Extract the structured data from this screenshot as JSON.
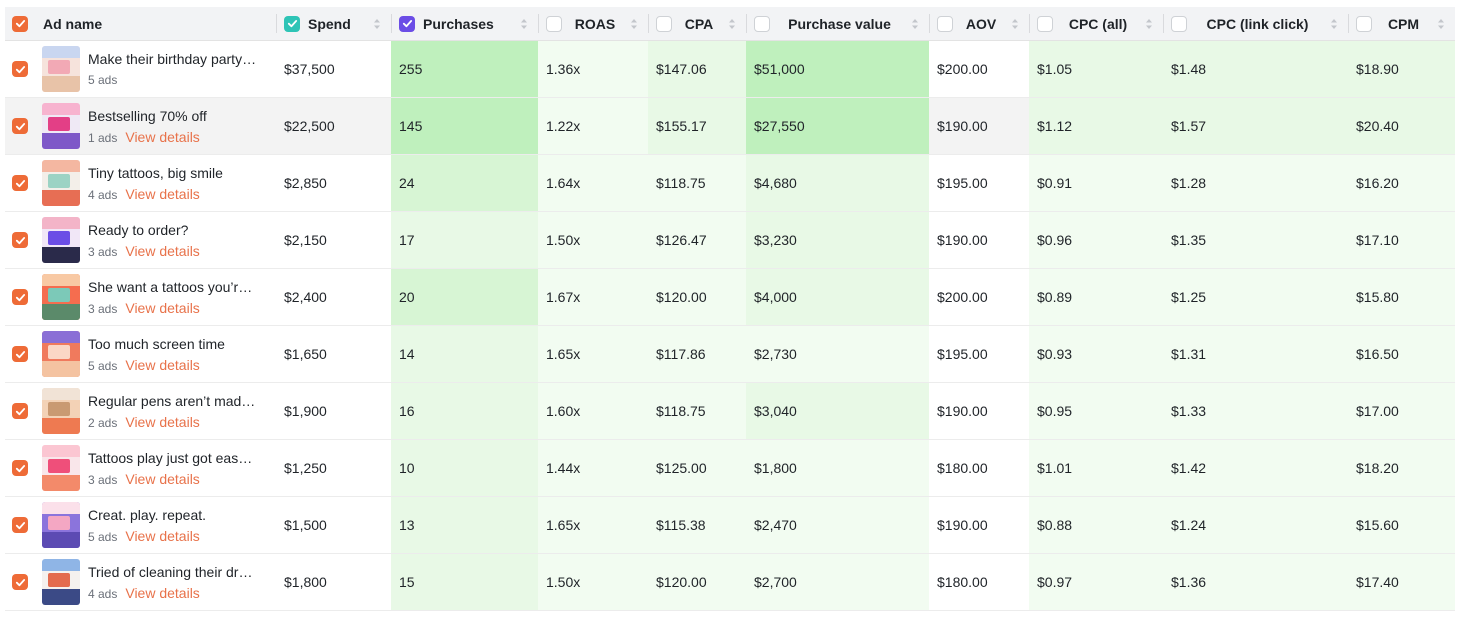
{
  "colors": {
    "accent": "#ee6b37",
    "spend_check": "#2ec4b6",
    "purchases_check": "#6b4de6",
    "link": "#e8724a",
    "heat_strong": "#bff0bd",
    "heat_medium": "#d7f5d4",
    "heat_light": "#e8f9e6",
    "heat_faint": "#f2fcf1"
  },
  "header": {
    "select_all_checked": true,
    "columns": [
      {
        "label": "Ad name",
        "checkbox": "orange"
      },
      {
        "label": "Spend",
        "checkbox": "teal"
      },
      {
        "label": "Purchases",
        "checkbox": "purple"
      },
      {
        "label": "ROAS",
        "checkbox": "empty"
      },
      {
        "label": "CPA",
        "checkbox": "empty"
      },
      {
        "label": "Purchase value",
        "checkbox": "empty"
      },
      {
        "label": "AOV",
        "checkbox": "empty"
      },
      {
        "label": "CPC (all)",
        "checkbox": "empty"
      },
      {
        "label": "CPC (link click)",
        "checkbox": "empty"
      },
      {
        "label": "CPM",
        "checkbox": "empty"
      }
    ]
  },
  "rows": [
    {
      "name": "Make their birthday party…",
      "ads": "5 ads",
      "view": "",
      "spend": "$37,500",
      "purchases": "255",
      "roas": "1.36x",
      "cpa": "$147.06",
      "purchase_value": "$51,000",
      "aov": "$200.00",
      "cpc_all": "$1.05",
      "cpc_link": "$1.48",
      "cpm": "$18.90",
      "highlight": false
    },
    {
      "name": "Bestselling 70% off",
      "ads": "1 ads",
      "view": "View details",
      "spend": "$22,500",
      "purchases": "145",
      "roas": "1.22x",
      "cpa": "$155.17",
      "purchase_value": "$27,550",
      "aov": "$190.00",
      "cpc_all": "$1.12",
      "cpc_link": "$1.57",
      "cpm": "$20.40",
      "highlight": true
    },
    {
      "name": "Tiny tattoos, big smile",
      "ads": "4 ads",
      "view": "View details",
      "spend": "$2,850",
      "purchases": "24",
      "roas": "1.64x",
      "cpa": "$118.75",
      "purchase_value": "$4,680",
      "aov": "$195.00",
      "cpc_all": "$0.91",
      "cpc_link": "$1.28",
      "cpm": "$16.20",
      "highlight": false
    },
    {
      "name": "Ready to order?",
      "ads": "3 ads",
      "view": "View details",
      "spend": "$2,150",
      "purchases": "17",
      "roas": "1.50x",
      "cpa": "$126.47",
      "purchase_value": "$3,230",
      "aov": "$190.00",
      "cpc_all": "$0.96",
      "cpc_link": "$1.35",
      "cpm": "$17.10",
      "highlight": false
    },
    {
      "name": "She want a tattoos you’r…",
      "ads": "3 ads",
      "view": "View details",
      "spend": "$2,400",
      "purchases": "20",
      "roas": "1.67x",
      "cpa": "$120.00",
      "purchase_value": "$4,000",
      "aov": "$200.00",
      "cpc_all": "$0.89",
      "cpc_link": "$1.25",
      "cpm": "$15.80",
      "highlight": false
    },
    {
      "name": "Too much screen time",
      "ads": "5 ads",
      "view": "View details",
      "spend": "$1,650",
      "purchases": "14",
      "roas": "1.65x",
      "cpa": "$117.86",
      "purchase_value": "$2,730",
      "aov": "$195.00",
      "cpc_all": "$0.93",
      "cpc_link": "$1.31",
      "cpm": "$16.50",
      "highlight": false
    },
    {
      "name": "Regular pens aren’t mad…",
      "ads": "2 ads",
      "view": "View details",
      "spend": "$1,900",
      "purchases": "16",
      "roas": "1.60x",
      "cpa": "$118.75",
      "purchase_value": "$3,040",
      "aov": "$190.00",
      "cpc_all": "$0.95",
      "cpc_link": "$1.33",
      "cpm": "$17.00",
      "highlight": false
    },
    {
      "name": "Tattoos play just got eas…",
      "ads": "3 ads",
      "view": "View details",
      "spend": "$1,250",
      "purchases": "10",
      "roas": "1.44x",
      "cpa": "$125.00",
      "purchase_value": "$1,800",
      "aov": "$180.00",
      "cpc_all": "$1.01",
      "cpc_link": "$1.42",
      "cpm": "$18.20",
      "highlight": false
    },
    {
      "name": "Creat. play. repeat.",
      "ads": "5 ads",
      "view": "View details",
      "spend": "$1,500",
      "purchases": "13",
      "roas": "1.65x",
      "cpa": "$115.38",
      "purchase_value": "$2,470",
      "aov": "$190.00",
      "cpc_all": "$0.88",
      "cpc_link": "$1.24",
      "cpm": "$15.60",
      "highlight": false
    },
    {
      "name": "Tried of cleaning their dra…",
      "ads": "4 ads",
      "view": "View details",
      "spend": "$1,800",
      "purchases": "15",
      "roas": "1.50x",
      "cpa": "$120.00",
      "purchase_value": "$2,700",
      "aov": "$180.00",
      "cpc_all": "$0.97",
      "cpc_link": "$1.36",
      "cpm": "$17.40",
      "highlight": false
    }
  ],
  "heat": [
    {
      "purchases": "strong",
      "roas": "faint",
      "cpa": "light",
      "purchase_value": "strong",
      "cpc_all": "light",
      "cpc_link": "light",
      "cpm": "light"
    },
    {
      "purchases": "strong",
      "roas": "faint",
      "cpa": "light",
      "purchase_value": "strong",
      "cpc_all": "light",
      "cpc_link": "light",
      "cpm": "light"
    },
    {
      "purchases": "medium",
      "roas": "faint",
      "cpa": "faint",
      "purchase_value": "light",
      "cpc_all": "faint",
      "cpc_link": "faint",
      "cpm": "faint"
    },
    {
      "purchases": "light",
      "roas": "faint",
      "cpa": "faint",
      "purchase_value": "light",
      "cpc_all": "faint",
      "cpc_link": "faint",
      "cpm": "faint"
    },
    {
      "purchases": "medium",
      "roas": "faint",
      "cpa": "faint",
      "purchase_value": "light",
      "cpc_all": "faint",
      "cpc_link": "faint",
      "cpm": "faint"
    },
    {
      "purchases": "light",
      "roas": "faint",
      "cpa": "faint",
      "purchase_value": "faint",
      "cpc_all": "faint",
      "cpc_link": "faint",
      "cpm": "faint"
    },
    {
      "purchases": "light",
      "roas": "faint",
      "cpa": "faint",
      "purchase_value": "light",
      "cpc_all": "faint",
      "cpc_link": "faint",
      "cpm": "faint"
    },
    {
      "purchases": "light",
      "roas": "faint",
      "cpa": "faint",
      "purchase_value": "faint",
      "cpc_all": "faint",
      "cpc_link": "faint",
      "cpm": "faint"
    },
    {
      "purchases": "light",
      "roas": "faint",
      "cpa": "faint",
      "purchase_value": "faint",
      "cpc_all": "faint",
      "cpc_link": "faint",
      "cpm": "faint"
    },
    {
      "purchases": "light",
      "roas": "faint",
      "cpa": "faint",
      "purchase_value": "faint",
      "cpc_all": "faint",
      "cpc_link": "faint",
      "cpm": "faint"
    }
  ]
}
